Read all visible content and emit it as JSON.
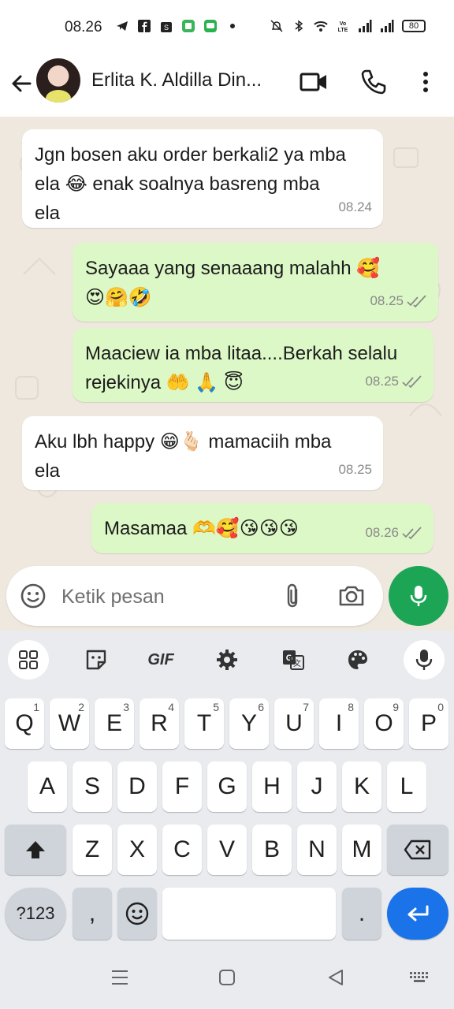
{
  "status_bar": {
    "time": "08.26",
    "battery": "80",
    "icons_left": [
      "telegram-icon",
      "facebook-icon",
      "shop-icon",
      "app-icon",
      "message-icon",
      "dot-icon"
    ],
    "icons_right": [
      "mute-icon",
      "bluetooth-icon",
      "wifi-icon",
      "volte-icon",
      "signal-icon",
      "signal-icon",
      "battery-icon"
    ]
  },
  "header": {
    "contact_name": "Erlita K. Aldilla Din...",
    "icons": [
      "back-arrow-icon",
      "video-call-icon",
      "phone-icon",
      "more-vert-icon"
    ]
  },
  "messages": [
    {
      "direction": "in",
      "text": "Jgn bosen aku order berkali2 ya mba\nela 😂 enak soalnya basreng mba\nela",
      "time": "08.24"
    },
    {
      "direction": "out",
      "text": "Sayaaa yang senaaang malahh 🥰\n😍🤗🤣",
      "time": "08.25",
      "status": "read"
    },
    {
      "direction": "out",
      "text": "Maaciew ia mba litaa....Berkah selalu\nrejekinya 🤲 🙏 😇",
      "time": "08.25",
      "status": "read"
    },
    {
      "direction": "in",
      "text": "Aku lbh happy 😁🫰🏻 mamaciih mba\nela",
      "time": "08.25"
    },
    {
      "direction": "out",
      "text": "Masamaa 🫶🥰😘😘😘",
      "time": "08.26",
      "status": "read"
    }
  ],
  "composer": {
    "placeholder": "Ketik pesan",
    "icons": [
      "emoji-icon",
      "attach-icon",
      "camera-icon",
      "mic-icon"
    ]
  },
  "keyboard": {
    "toolbar": {
      "gif_label": "GIF",
      "icons": [
        "apps-grid-icon",
        "sticker-icon",
        "gif-icon",
        "settings-icon",
        "translate-icon",
        "palette-icon",
        "voice-input-icon"
      ]
    },
    "row1": [
      {
        "label": "Q",
        "hint": "1"
      },
      {
        "label": "W",
        "hint": "2"
      },
      {
        "label": "E",
        "hint": "3"
      },
      {
        "label": "R",
        "hint": "4"
      },
      {
        "label": "T",
        "hint": "5"
      },
      {
        "label": "Y",
        "hint": "6"
      },
      {
        "label": "U",
        "hint": "7"
      },
      {
        "label": "I",
        "hint": "8"
      },
      {
        "label": "O",
        "hint": "9"
      },
      {
        "label": "P",
        "hint": "0"
      }
    ],
    "row2": [
      "A",
      "S",
      "D",
      "F",
      "G",
      "H",
      "J",
      "K",
      "L"
    ],
    "row3": [
      "Z",
      "X",
      "C",
      "V",
      "B",
      "N",
      "M"
    ],
    "symbols_label": "?123",
    "comma_label": ",",
    "period_label": "."
  },
  "nav_bar": {
    "icons": [
      "recents-icon",
      "home-icon",
      "back-icon",
      "keyboard-switch-icon"
    ]
  },
  "colors": {
    "outgoing_bubble": "#dcf8c6",
    "incoming_bubble": "#ffffff",
    "chat_background": "#efe8de",
    "mic_button": "#1da556",
    "enter_key": "#1a73e8",
    "read_ticks": "#8a8a8a"
  }
}
